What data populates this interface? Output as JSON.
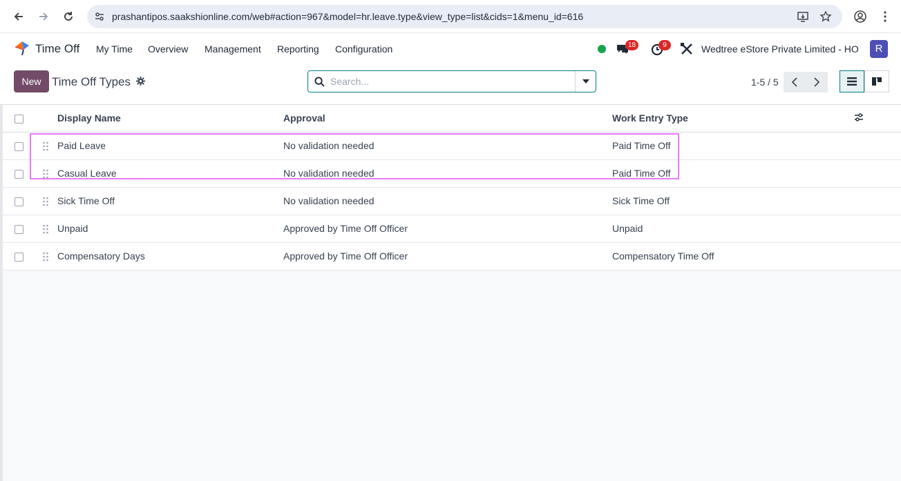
{
  "browser": {
    "url": "prashantipos.saakshionline.com/web#action=967&model=hr.leave.type&view_type=list&cids=1&menu_id=616"
  },
  "navbar": {
    "app_name": "Time Off",
    "menu": [
      "My Time",
      "Overview",
      "Management",
      "Reporting",
      "Configuration"
    ],
    "messages_count": "18",
    "activities_count": "9",
    "company": "Wedtree eStore Private Limited - HO",
    "avatar_initial": "R",
    "avatar_color": "#4c4fb3",
    "status_color": "#16a34a"
  },
  "control_panel": {
    "new_label": "New",
    "title": "Time Off Types",
    "search_placeholder": "Search...",
    "pager": "1-5 / 5",
    "brand_color": "#714b67",
    "accent_color": "#017e84"
  },
  "list": {
    "columns": {
      "display_name": "Display Name",
      "approval": "Approval",
      "work_entry_type": "Work Entry Type"
    },
    "rows": [
      {
        "display_name": "Paid Leave",
        "approval": "No validation needed",
        "work_entry_type": "Paid Time Off"
      },
      {
        "display_name": "Casual Leave",
        "approval": "No validation needed",
        "work_entry_type": "Paid Time Off"
      },
      {
        "display_name": "Sick Time Off",
        "approval": "No validation needed",
        "work_entry_type": "Sick Time Off"
      },
      {
        "display_name": "Unpaid",
        "approval": "Approved by Time Off Officer",
        "work_entry_type": "Unpaid"
      },
      {
        "display_name": "Compensatory Days",
        "approval": "Approved by Time Off Officer",
        "work_entry_type": "Compensatory Time Off"
      }
    ]
  }
}
